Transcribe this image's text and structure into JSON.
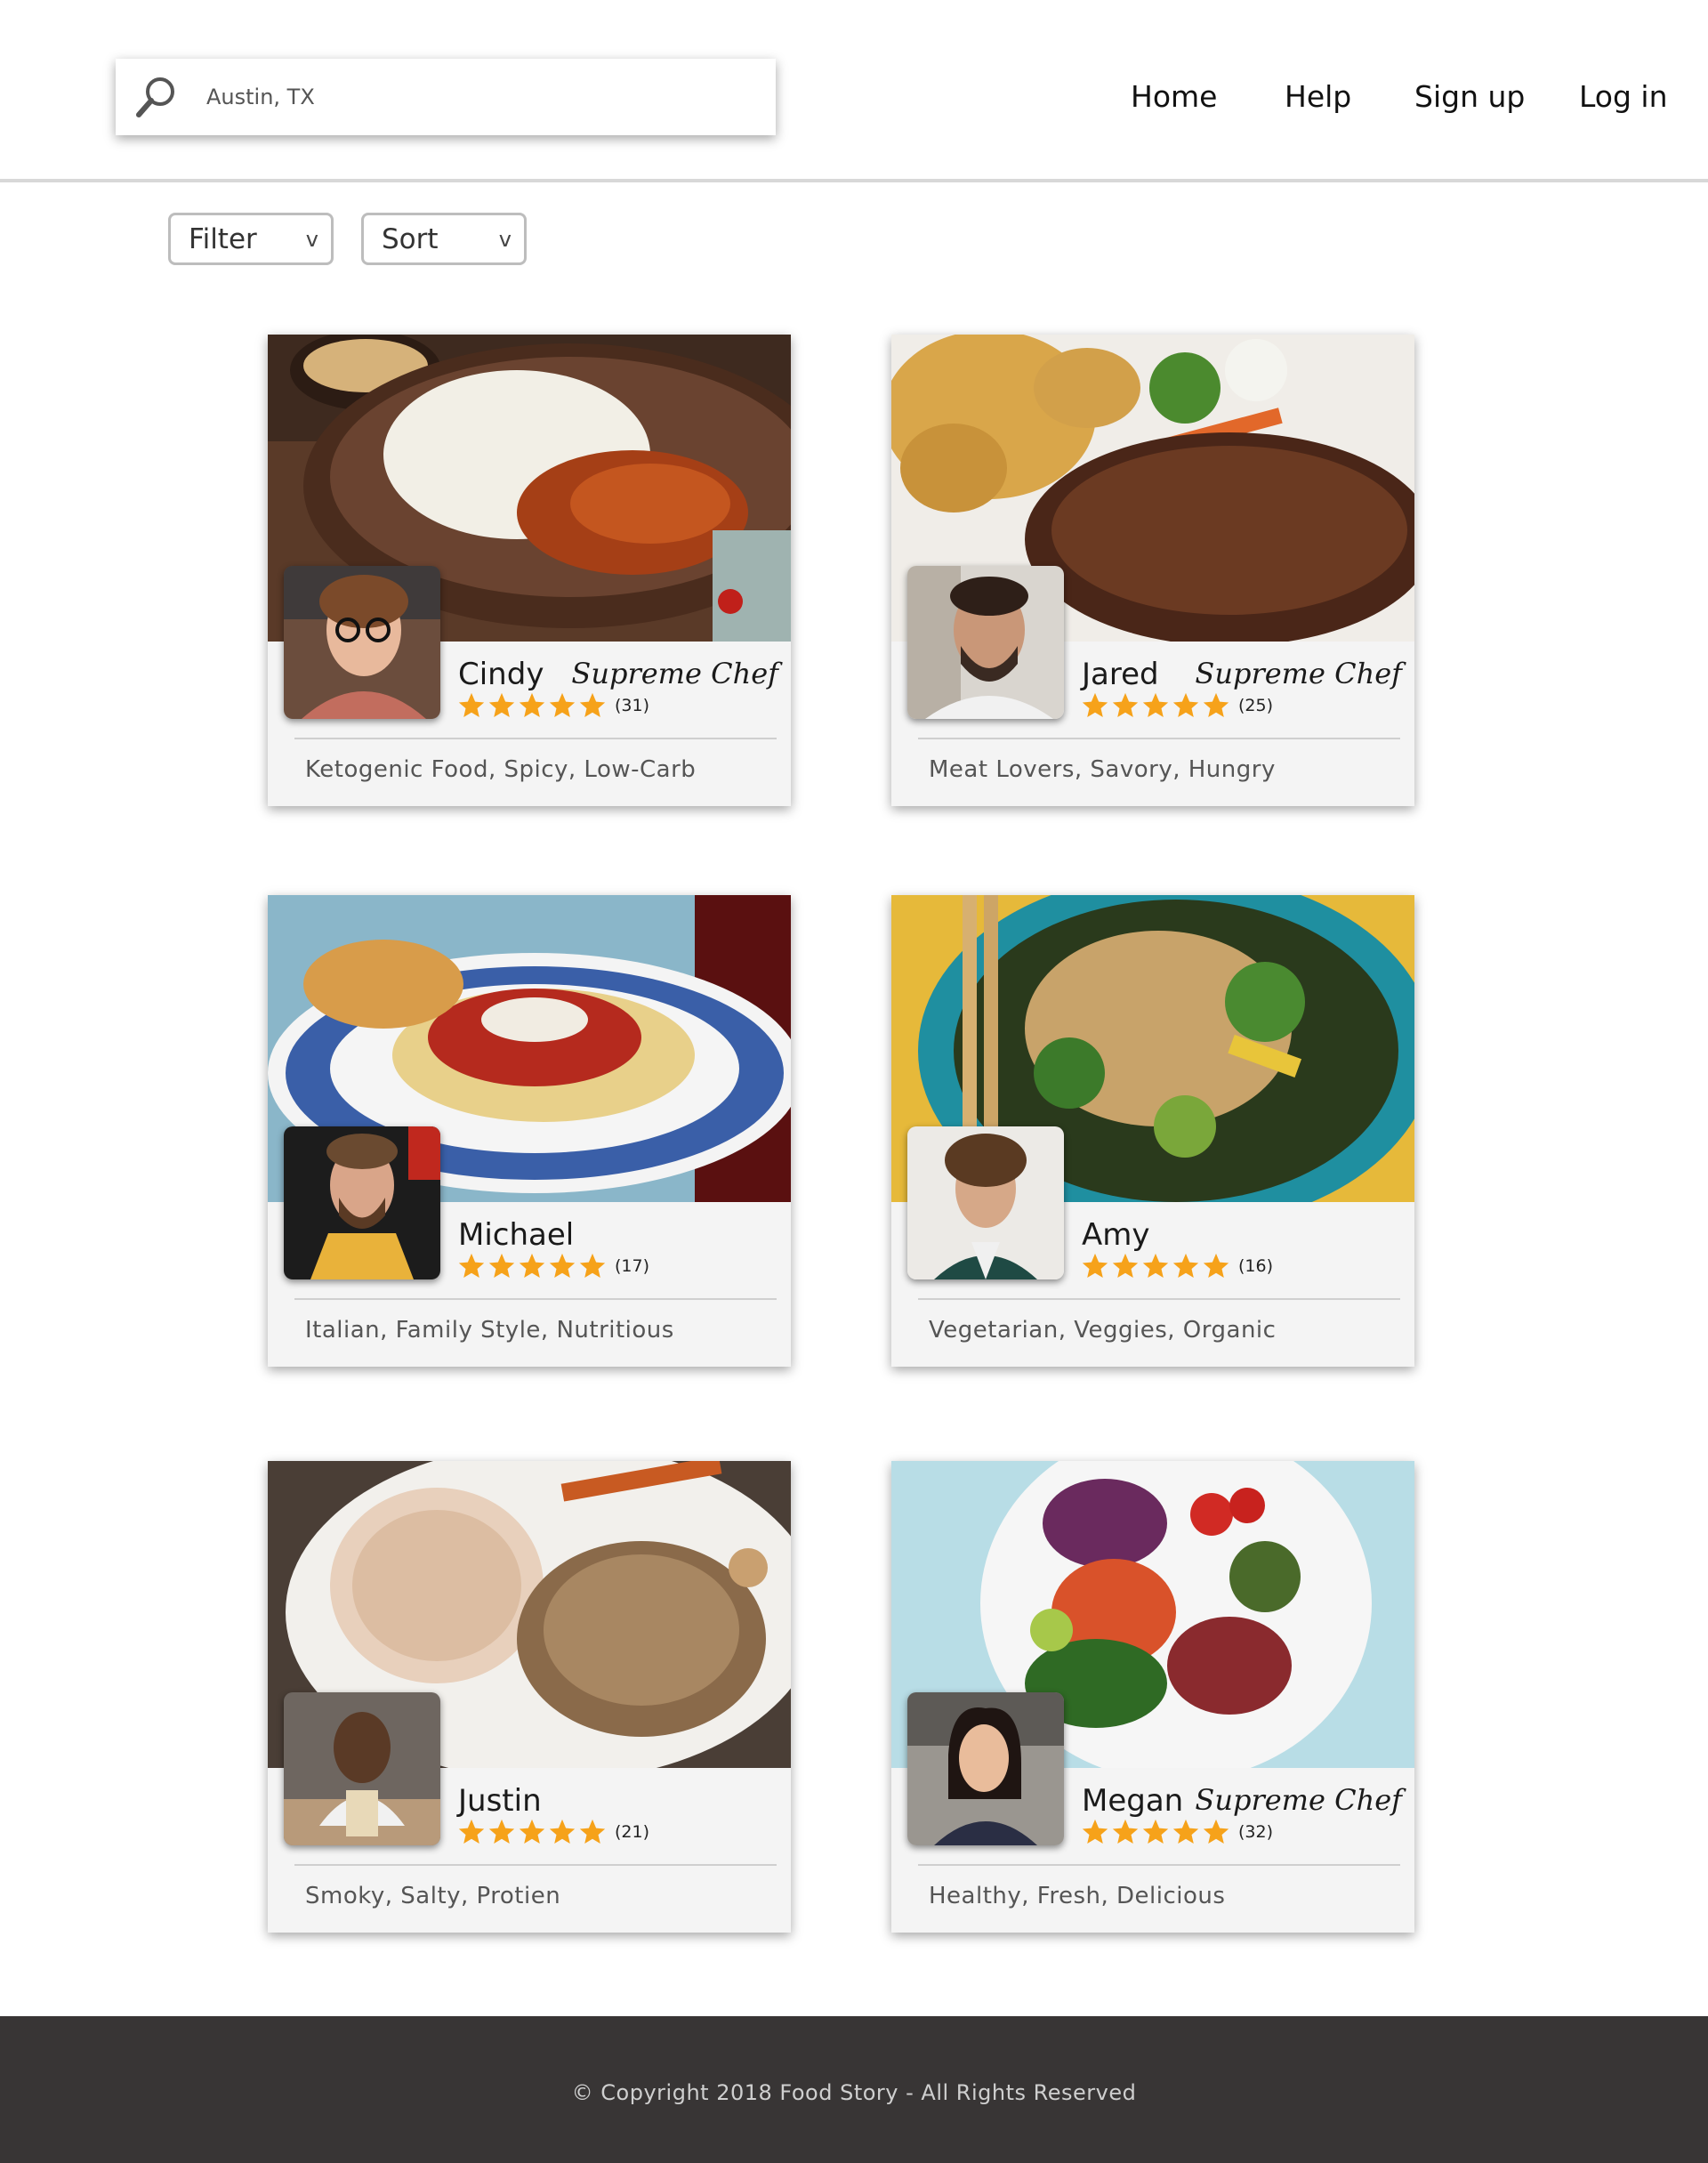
{
  "search": {
    "value": "Austin, TX",
    "icon": "search-icon"
  },
  "nav": {
    "home": "Home",
    "help": "Help",
    "signup": "Sign up",
    "login": "Log in"
  },
  "controls": {
    "filter": "Filter",
    "sort": "Sort",
    "chevron": "v"
  },
  "accent": {
    "star": "#f6a21a",
    "footer": "#383535"
  },
  "cards": [
    {
      "name": "Cindy",
      "title": "Supreme Chef",
      "rating": 5,
      "reviews": "(31)",
      "tags": "Ketogenic Food, Spicy, Low-Carb"
    },
    {
      "name": "Jared",
      "title": "Supreme Chef",
      "rating": 5,
      "reviews": "(25)",
      "tags": "Meat Lovers, Savory, Hungry"
    },
    {
      "name": "Michael",
      "title": "",
      "rating": 5,
      "reviews": "(17)",
      "tags": "Italian, Family Style, Nutritious"
    },
    {
      "name": "Amy",
      "title": "",
      "rating": 5,
      "reviews": "(16)",
      "tags": "Vegetarian, Veggies, Organic"
    },
    {
      "name": "Justin",
      "title": "",
      "rating": 5,
      "reviews": "(21)",
      "tags": "Smoky, Salty, Protien"
    },
    {
      "name": "Megan",
      "title": "Supreme Chef",
      "rating": 5,
      "reviews": "(32)",
      "tags": "Healthy, Fresh, Delicious"
    }
  ],
  "footer": {
    "copyright": "© Copyright 2018 Food Story - All Rights Reserved"
  }
}
